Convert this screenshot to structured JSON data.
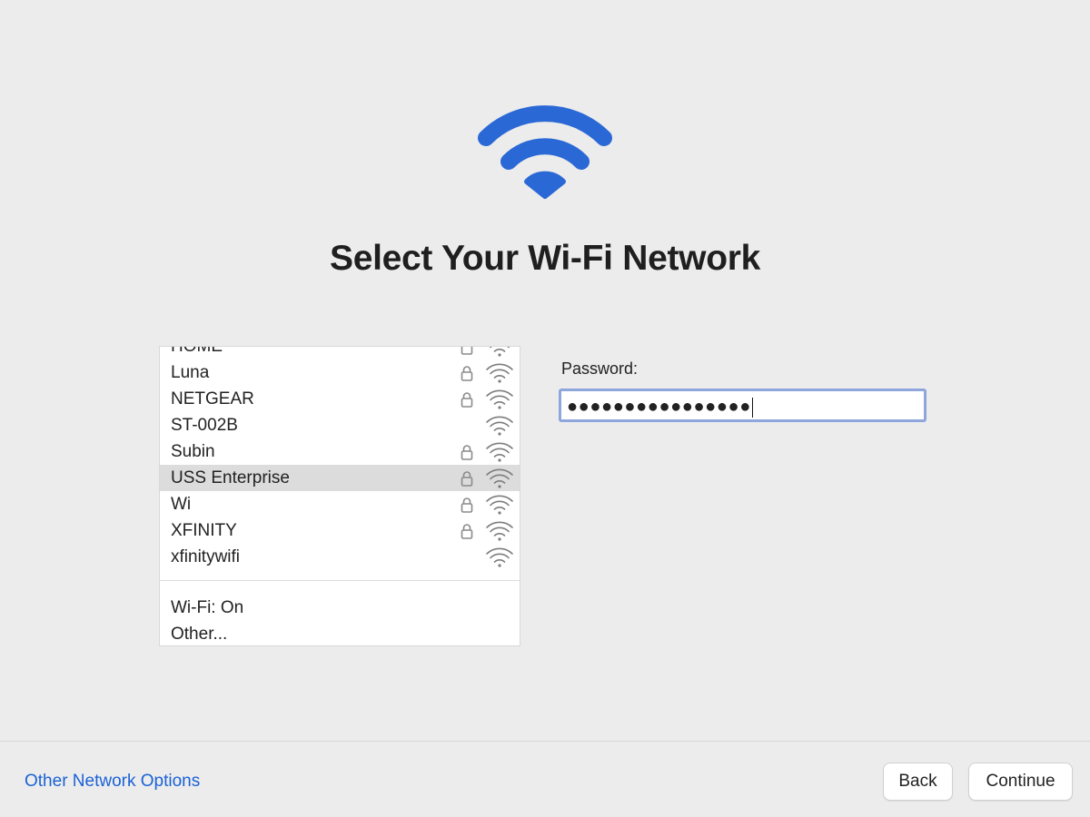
{
  "title": "Select Your Wi-Fi Network",
  "colors": {
    "accent": "#2a68d6",
    "link": "#1a62d6",
    "selected_row": "#dcdcdc"
  },
  "networks": [
    {
      "name": "HOME",
      "locked": true,
      "signal_icon": "wifi-signal-icon",
      "partially_visible": true
    },
    {
      "name": "Luna",
      "locked": true,
      "signal_icon": "wifi-signal-icon"
    },
    {
      "name": "NETGEAR",
      "locked": true,
      "signal_icon": "wifi-signal-icon"
    },
    {
      "name": "ST-002B",
      "locked": false,
      "signal_icon": "wifi-signal-icon"
    },
    {
      "name": "Subin",
      "locked": true,
      "signal_icon": "wifi-signal-icon"
    },
    {
      "name": "USS Enterprise",
      "locked": true,
      "signal_icon": "wifi-signal-icon",
      "selected": true
    },
    {
      "name": "Wi",
      "locked": true,
      "signal_icon": "wifi-signal-icon"
    },
    {
      "name": "XFINITY",
      "locked": true,
      "signal_icon": "wifi-signal-icon"
    },
    {
      "name": "xfinitywifi",
      "locked": false,
      "signal_icon": "wifi-signal-icon"
    }
  ],
  "list_footer": {
    "wifi_status": "Wi-Fi: On",
    "other": "Other..."
  },
  "password": {
    "label": "Password:",
    "masked_value": "●●●●●●●●●●●●●●●●"
  },
  "bottom": {
    "other_network_options": "Other Network Options",
    "back_label": "Back",
    "continue_label": "Continue"
  }
}
